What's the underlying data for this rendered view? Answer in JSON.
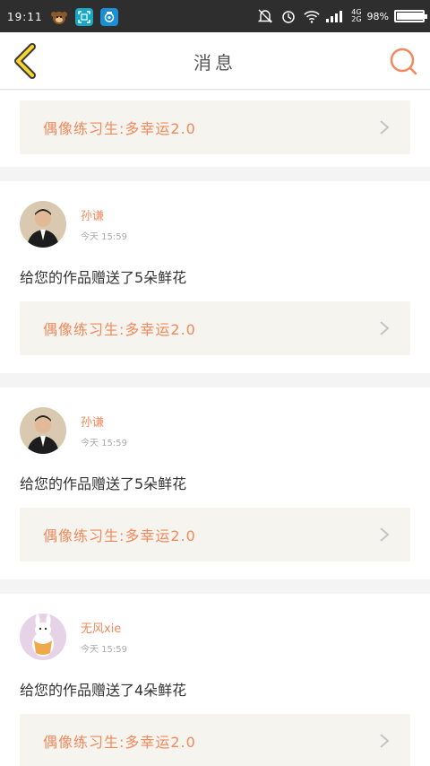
{
  "status_bar": {
    "time": "19:11",
    "network": [
      "4G",
      "2G"
    ],
    "battery_text": "98%",
    "battery_level": 0.98,
    "icons": [
      "monkey-app-icon",
      "screenshot-app-icon",
      "camera-app-icon",
      "bell-muted-icon",
      "alarm-icon",
      "wifi-icon",
      "signal-icon",
      "battery-icon"
    ]
  },
  "header": {
    "title": "消息",
    "back_icon": "chevron-left-icon",
    "search_icon": "search-icon"
  },
  "top_work": {
    "title": "偶像练习生:多幸运2.0"
  },
  "messages": [
    {
      "user": "孙谦",
      "time": "今天 15:59",
      "text": "给您的作品赠送了5朵鲜花",
      "work_title": "偶像练习生:多幸运2.0"
    },
    {
      "user": "孙谦",
      "time": "今天 15:59",
      "text": "给您的作品赠送了5朵鲜花",
      "work_title": "偶像练习生:多幸运2.0"
    },
    {
      "user": "无风xie",
      "time": "今天 15:59",
      "text": "给您的作品赠送了4朵鲜花",
      "work_title": "偶像练习生:多幸运2.0"
    }
  ],
  "colors": {
    "accent": "#f08a5d",
    "back_yellow": "#f6d531",
    "work_bg": "#f5f4ee"
  }
}
